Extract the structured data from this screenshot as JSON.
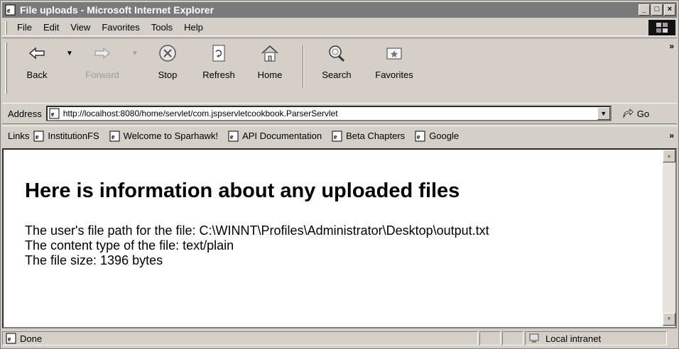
{
  "window": {
    "title": "File uploads - Microsoft Internet Explorer",
    "controls": [
      "minimize-button",
      "maximize-button",
      "close-button"
    ]
  },
  "menu": {
    "items": [
      {
        "label": "File"
      },
      {
        "label": "Edit"
      },
      {
        "label": "View"
      },
      {
        "label": "Favorites"
      },
      {
        "label": "Tools"
      },
      {
        "label": "Help"
      }
    ]
  },
  "toolbar": {
    "back_label": "Back",
    "forward_label": "Forward",
    "stop_label": "Stop",
    "refresh_label": "Refresh",
    "home_label": "Home",
    "search_label": "Search",
    "favorites_label": "Favorites",
    "more_label": "»"
  },
  "address": {
    "label": "Address",
    "url": "http://localhost:8080/home/servlet/com.jspservletcookbook.ParserServlet",
    "go_label": "Go"
  },
  "links": {
    "label": "Links",
    "items": [
      {
        "label": "InstitutionFS"
      },
      {
        "label": "Welcome to Sparhawk!"
      },
      {
        "label": "API Documentation"
      },
      {
        "label": "Beta Chapters"
      },
      {
        "label": "Google"
      }
    ],
    "more_label": "»"
  },
  "page": {
    "heading": "Here is information about any uploaded files",
    "lines": [
      "The user's file path for the file: C:\\WINNT\\Profiles\\Administrator\\Desktop\\output.txt",
      "The content type of the file: text/plain",
      "The file size: 1396 bytes"
    ]
  },
  "status": {
    "text": "Done",
    "zone": "Local intranet"
  },
  "icons": {
    "ie_page": "ie-page-icon",
    "back": "back-arrow-icon",
    "forward": "forward-arrow-icon",
    "stop": "stop-icon",
    "refresh": "refresh-icon",
    "home": "home-icon",
    "search": "search-icon",
    "favorites": "favorites-icon",
    "go": "go-arrow-icon",
    "zone": "local-intranet-icon"
  }
}
